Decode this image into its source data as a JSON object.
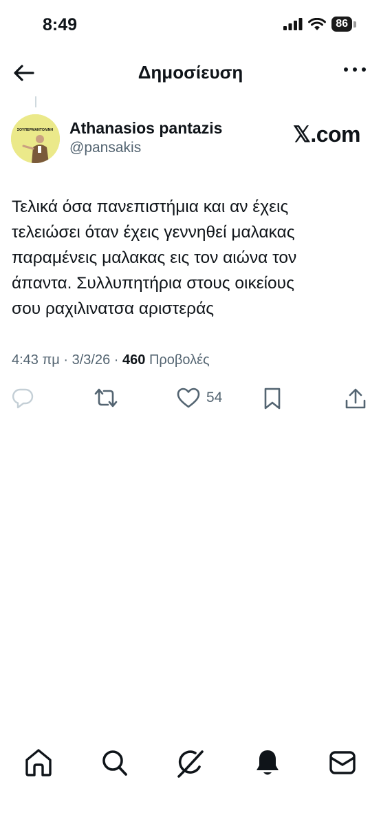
{
  "status_bar": {
    "time": "8:49",
    "battery": "86"
  },
  "header": {
    "title": "Δημοσίευση"
  },
  "author": {
    "name": "Athanasios pantazis",
    "handle": "@pansakis",
    "avatar_text": "ΣΟΥΠΕΡΜΑΝΤΟΛΙΝΗ"
  },
  "watermark": "𝕏.com",
  "post": {
    "text_lines": [
      "Τελικά όσα πανεπιστήμια και αν έχεις",
      "τελειώσει όταν έχεις γεννηθεί μαλακας",
      "παραμένεις μαλακας εις τον αιώνα τον",
      "άπαντα. Συλλυπητήρια στους οικείους",
      "σου ραχιλινατσα αριστεράς"
    ],
    "time": "4:43 πμ",
    "date": "3/3/26",
    "separator": "·",
    "views_count": "460",
    "views_label": "Προβολές",
    "likes": "54"
  },
  "icons": {
    "reply": "reply-icon",
    "retweet": "retweet-icon",
    "like": "heart-icon",
    "bookmark": "bookmark-icon",
    "share": "share-icon",
    "home": "home-icon",
    "search": "search-icon",
    "grok": "grok-icon",
    "notifications": "bell-icon",
    "messages": "mail-icon"
  }
}
